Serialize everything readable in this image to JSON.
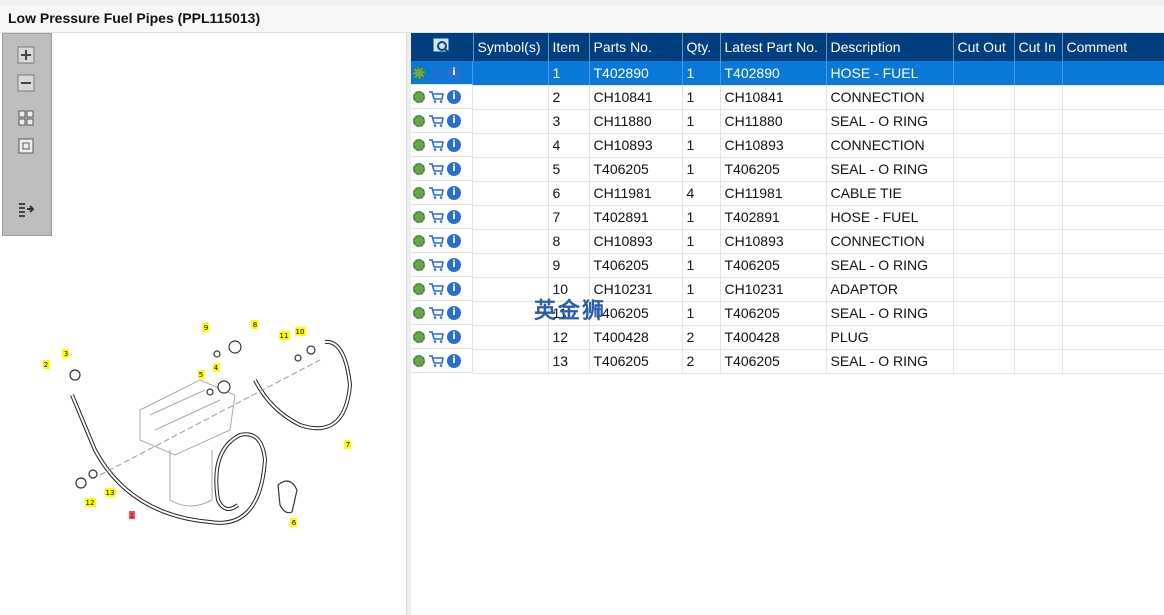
{
  "page": {
    "title": "Low Pressure Fuel Pipes (PPL115013)"
  },
  "toolbar": {
    "buttons": [
      "zoom-in-icon",
      "zoom-out-icon",
      "fit-all-icon",
      "fit-window-icon",
      "export-list-icon"
    ]
  },
  "table": {
    "columns": [
      "",
      "Symbol(s)",
      "Item",
      "Parts No.",
      "Qty.",
      "Latest Part No.",
      "Description",
      "Cut Out",
      "Cut In",
      "Comment"
    ],
    "rows": [
      {
        "item": "1",
        "part": "T402890",
        "qty": "1",
        "latest": "T402890",
        "desc": "HOSE - FUEL"
      },
      {
        "item": "2",
        "part": "CH10841",
        "qty": "1",
        "latest": "CH10841",
        "desc": "CONNECTION"
      },
      {
        "item": "3",
        "part": "CH11880",
        "qty": "1",
        "latest": "CH11880",
        "desc": "SEAL - O RING"
      },
      {
        "item": "4",
        "part": "CH10893",
        "qty": "1",
        "latest": "CH10893",
        "desc": "CONNECTION"
      },
      {
        "item": "5",
        "part": "T406205",
        "qty": "1",
        "latest": "T406205",
        "desc": "SEAL - O RING"
      },
      {
        "item": "6",
        "part": "CH11981",
        "qty": "4",
        "latest": "CH11981",
        "desc": "CABLE TIE"
      },
      {
        "item": "7",
        "part": "T402891",
        "qty": "1",
        "latest": "T402891",
        "desc": "HOSE - FUEL"
      },
      {
        "item": "8",
        "part": "CH10893",
        "qty": "1",
        "latest": "CH10893",
        "desc": "CONNECTION"
      },
      {
        "item": "9",
        "part": "T406205",
        "qty": "1",
        "latest": "T406205",
        "desc": "SEAL - O RING"
      },
      {
        "item": "10",
        "part": "CH10231",
        "qty": "1",
        "latest": "CH10231",
        "desc": "ADAPTOR"
      },
      {
        "item": "11",
        "part": "T406205",
        "qty": "1",
        "latest": "T406205",
        "desc": "SEAL - O RING"
      },
      {
        "item": "12",
        "part": "T400428",
        "qty": "2",
        "latest": "T400428",
        "desc": "PLUG"
      },
      {
        "item": "13",
        "part": "T406205",
        "qty": "2",
        "latest": "T406205",
        "desc": "SEAL - O RING"
      }
    ]
  },
  "diagram": {
    "labels": [
      "1",
      "2",
      "3",
      "4",
      "5",
      "6",
      "7",
      "8",
      "9",
      "10",
      "11",
      "12",
      "13"
    ]
  },
  "watermark": "英金狮",
  "colors": {
    "header": "#003f7f",
    "selected": "#0a78d6",
    "callout": "#ffff00"
  }
}
